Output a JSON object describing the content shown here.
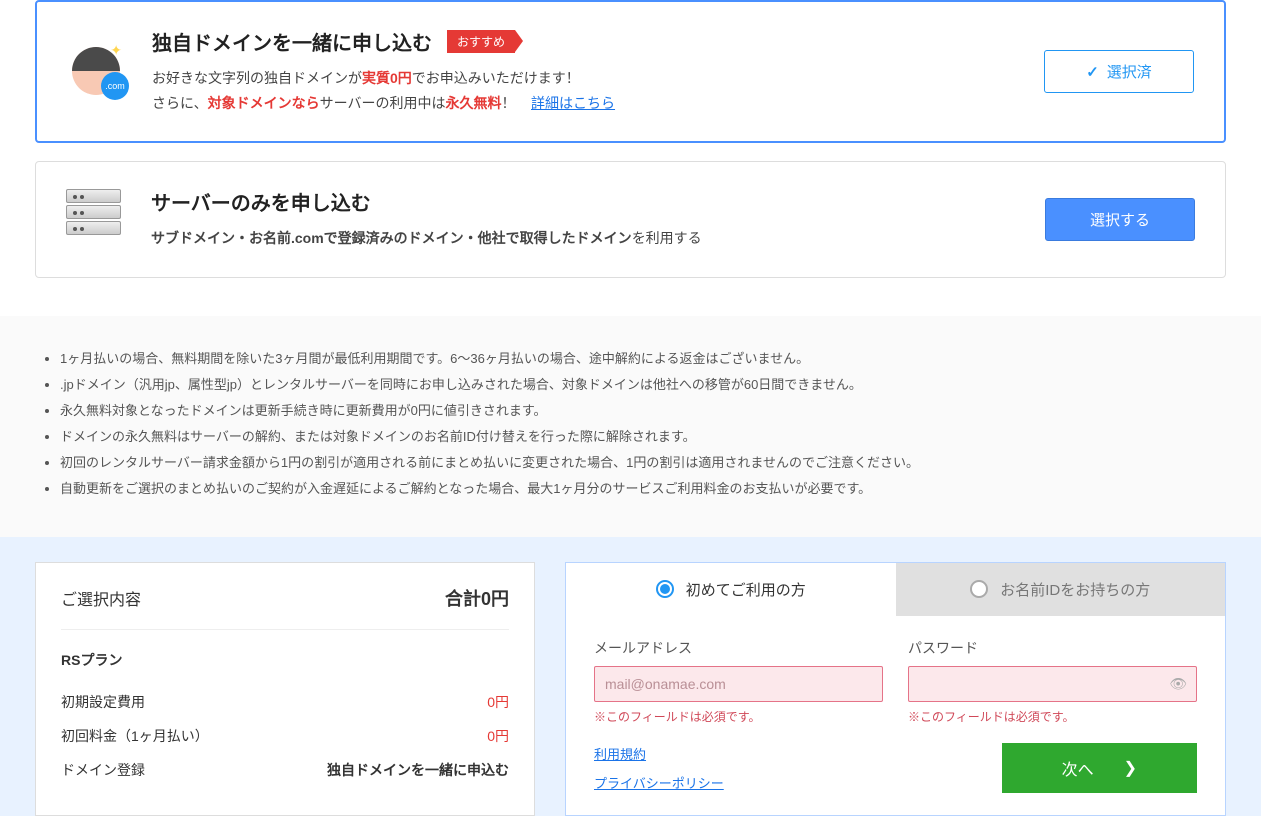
{
  "options": {
    "domain": {
      "title": "独自ドメインを一緒に申し込む",
      "badge": "おすすめ",
      "desc1_pre": "お好きな文字列の独自ドメインが",
      "desc1_em": "実質0円",
      "desc1_post": "でお申込みいただけます！",
      "desc2_pre": "さらに、",
      "desc2_em1": "対象ドメインなら",
      "desc2_mid": "サーバーの利用中は",
      "desc2_em2": "永久無料",
      "desc2_post": "！",
      "link": "詳細はこちら",
      "button": "選択済",
      "com_label": ".com"
    },
    "server": {
      "title": "サーバーのみを申し込む",
      "desc_bold": "サブドメイン・お名前.comで登録済みのドメイン・他社で取得したドメイン",
      "desc_post": "を利用する",
      "button": "選択する"
    }
  },
  "notes": [
    "1ヶ月払いの場合、無料期間を除いた3ヶ月間が最低利用期間です。6～36ヶ月払いの場合、途中解約による返金はございません。",
    ".jpドメイン（汎用jp、属性型jp）とレンタルサーバーを同時にお申し込みされた場合、対象ドメインは他社への移管が60日間できません。",
    "永久無料対象となったドメインは更新手続き時に更新費用が0円に値引きされます。",
    "ドメインの永久無料はサーバーの解約、または対象ドメインのお名前ID付け替えを行った際に解除されます。",
    "初回のレンタルサーバー請求金額から1円の割引が適用される前にまとめ払いに変更された場合、1円の割引は適用されませんのでご注意ください。",
    "自動更新をご選択のまとめ払いのご契約が入金遅延によるご解約となった場合、最大1ヶ月分のサービスご利用料金のお支払いが必要です。"
  ],
  "summary": {
    "title": "ご選択内容",
    "total_label": "合計0円",
    "plan": "RSプラン",
    "rows": [
      {
        "label": "初期設定費用",
        "value": "0円",
        "price": true
      },
      {
        "label": "初回料金（1ヶ月払い）",
        "value": "0円",
        "price": true
      },
      {
        "label": "ドメイン登録",
        "value": "独自ドメインを一緒に申込む",
        "price": false
      }
    ]
  },
  "form": {
    "tab1": "初めてご利用の方",
    "tab2": "お名前IDをお持ちの方",
    "email_label": "メールアドレス",
    "email_placeholder": "mail@onamae.com",
    "password_label": "パスワード",
    "err": "※このフィールドは必須です。",
    "link_terms": "利用規約",
    "link_privacy": "プライバシーポリシー",
    "next": "次へ"
  }
}
